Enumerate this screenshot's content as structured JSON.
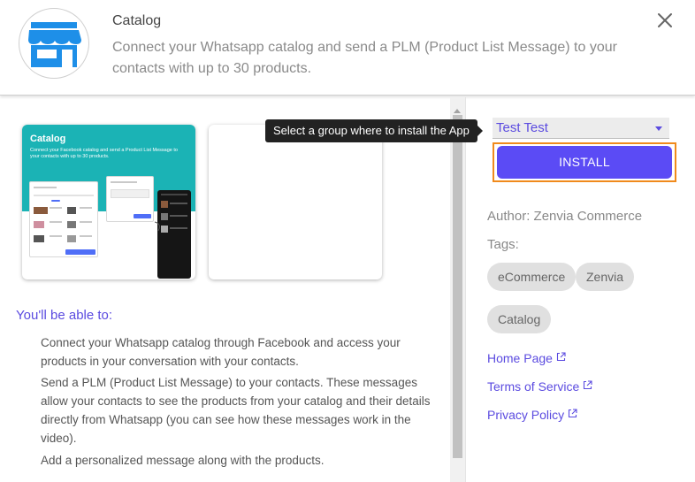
{
  "header": {
    "title": "Catalog",
    "description": "Connect your Whatsapp catalog and send a PLM (Product List Message) to your contacts with up to 30 products.",
    "logo_icon": "storefront-icon",
    "close_icon": "close-icon"
  },
  "preview": {
    "thumbnail": {
      "title": "Catalog",
      "subtitle": "Connect your Facebook catalog and send a Product List Message to your contacts with up to 30 products."
    }
  },
  "features": {
    "title": "You'll be able to:",
    "items": [
      "Connect your Whatsapp catalog through Facebook and access your products in your conversation with your contacts.",
      "Send a PLM (Product List Message) to your contacts. These messages allow your contacts to see the products from your catalog and their details directly from Whatsapp (you can see how these messages work in the video).",
      "Add a personalized message along with the products."
    ]
  },
  "sidebar": {
    "tooltip": "Select a group where to install the App",
    "group_select": {
      "value": "Test Test"
    },
    "install_label": "INSTALL",
    "author": "Author: Zenvia Commerce",
    "tags_label": "Tags:",
    "tags": [
      "eCommerce",
      "Zenvia",
      "Catalog"
    ],
    "links": [
      {
        "label": "Home Page",
        "icon": "external-link-icon"
      },
      {
        "label": "Terms of Service",
        "icon": "external-link-icon"
      },
      {
        "label": "Privacy Policy",
        "icon": "external-link-icon"
      }
    ]
  },
  "colors": {
    "accent": "#5b4be0",
    "install_button": "#5b4bf5",
    "focus_outline": "#f08a1c",
    "logo_blue": "#1e8fe8",
    "thumbnail_teal": "#1bb3b5"
  }
}
